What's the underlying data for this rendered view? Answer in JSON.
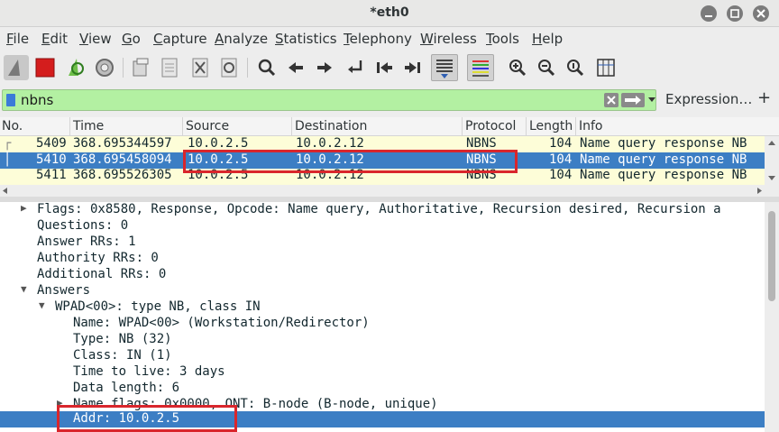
{
  "window": {
    "title": "*eth0"
  },
  "menu": [
    "File",
    "Edit",
    "View",
    "Go",
    "Capture",
    "Analyze",
    "Statistics",
    "Telephony",
    "Wireless",
    "Tools",
    "Help"
  ],
  "menu_underline": [
    "F",
    "E",
    "V",
    "G",
    "C",
    "A",
    "S",
    "T",
    "W",
    "T",
    "H"
  ],
  "menu_rest": [
    "ile",
    "dit",
    "iew",
    "o",
    "apture",
    "nalyze",
    "tatistics",
    "elephony",
    "ireless",
    "ools",
    "elp"
  ],
  "filter": {
    "value": "nbns",
    "expression_label": "Expression…",
    "plus_label": "+"
  },
  "packet_list": {
    "columns": [
      "No.",
      "Time",
      "Source",
      "Destination",
      "Protocol",
      "Length",
      "Info"
    ],
    "rows": [
      {
        "no": "5409",
        "time": "368.695344597",
        "source": "10.0.2.5",
        "destination": "10.0.2.12",
        "protocol": "NBNS",
        "length": "104",
        "info": "Name query response NB"
      },
      {
        "no": "5410",
        "time": "368.695458094",
        "source": "10.0.2.5",
        "destination": "10.0.2.12",
        "protocol": "NBNS",
        "length": "104",
        "info": "Name query response NB"
      },
      {
        "no": "5411",
        "time": "368.695526305",
        "source": "10.0.2.5",
        "destination": "10.0.2.12",
        "protocol": "NBNS",
        "length": "104",
        "info": "Name query response NB"
      }
    ]
  },
  "details": [
    "Flags: 0x8580, Response, Opcode: Name query, Authoritative, Recursion desired, Recursion a",
    "Questions: 0",
    "Answer RRs: 1",
    "Authority RRs: 0",
    "Additional RRs: 0",
    "Answers",
    "WPAD<00>: type NB, class IN",
    "Name: WPAD<00> (Workstation/Redirector)",
    "Type: NB (32)",
    "Class: IN (1)",
    "Time to live: 3 days",
    "Data length: 6",
    "Name flags: 0x0000, ONT: B-node (B-node, unique)",
    "Addr: 10.0.2.5"
  ],
  "colors": {
    "selected": "#3c7ec4",
    "row_bg": "#fdfdd8",
    "filter_bg": "#b3f0a2",
    "highlight": "#d9262c"
  }
}
